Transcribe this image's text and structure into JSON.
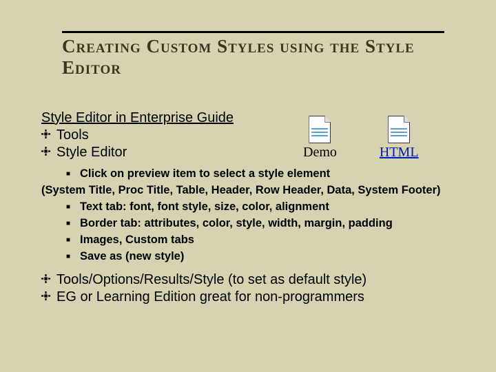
{
  "title": "Creating Custom Styles using the Style Editor",
  "intro": "Style Editor in Enterprise Guide",
  "files": {
    "demo": {
      "label": "Demo"
    },
    "html": {
      "label": "HTML"
    }
  },
  "lvl1_top": [
    "Tools",
    "Style Editor"
  ],
  "lvl2": [
    "Click on preview item to select a style element",
    "(System Title, Proc Title, Table, Header, Row Header, Data, System Footer)",
    "Text tab: font, font style, size, color, alignment",
    "Border tab: attributes, color, style, width, margin, padding",
    "Images, Custom tabs",
    "Save as (new style)"
  ],
  "lvl1_bottom": [
    "Tools/Options/Results/Style (to set as default style)",
    "EG or Learning Edition great for non-programmers"
  ]
}
